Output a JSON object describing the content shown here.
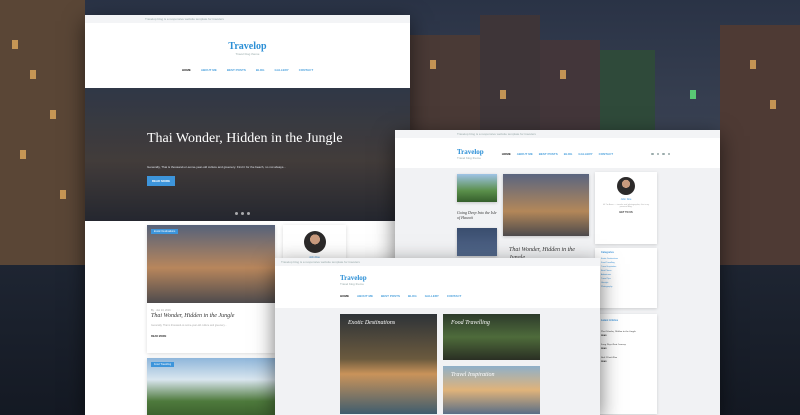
{
  "brand": {
    "name": "Travelop",
    "tagline": "Travel blog theme"
  },
  "top_strip_text": "Travelop blog is a responsive website template for travelers",
  "nav": [
    "HOME",
    "ABOUT ME",
    "BEST POSTS",
    "BLOG",
    "GALLERY",
    "CONTACT"
  ],
  "hero": {
    "title": "Thai Wonder, Hidden in the Jungle",
    "subtitle": "Generally, Thai is thousand-or-some-year-old culture and greenery. Find it for the beach, no not always...",
    "button": "READ MORE"
  },
  "post1": {
    "tag": "Exotic Destinations",
    "meta": "By · Jun 13, 2016",
    "title": "Thai Wonder, Hidden in the Jungle",
    "excerpt": "Generally, Thai is thousand-or-some-year-old culture and greenery...",
    "more": "READ MORE"
  },
  "author": {
    "name": "John Doe",
    "bio": "Hi! I'm Anna — traveler and photographer, this is my personal blog.",
    "more": "GET TO US"
  },
  "post2_tag": "Food Travelling",
  "mock2": {
    "small_post_title": "Going Deep Into the Isle of Hawaii",
    "featured_title": "Thai Wonder, Hidden in the Jungle",
    "categories_title": "Categories",
    "categories": [
      "Exotic Destinations",
      "Food Travelling",
      "Travel Inspiration",
      "Best Places",
      "Adventures",
      "Travel Tips",
      "Lifestyle",
      "Photography"
    ],
    "latest_title": "Latest Articles",
    "latest": [
      "Thai Wonder, Hidden in the Jungle",
      "Long Days Boat Journey",
      "Bali Climb Blue"
    ],
    "latest_more": "READ"
  },
  "mock3": {
    "card_a": "Exotic Destinations",
    "card_b": "Food Travelling",
    "card_c": "Travel Inspiration"
  }
}
